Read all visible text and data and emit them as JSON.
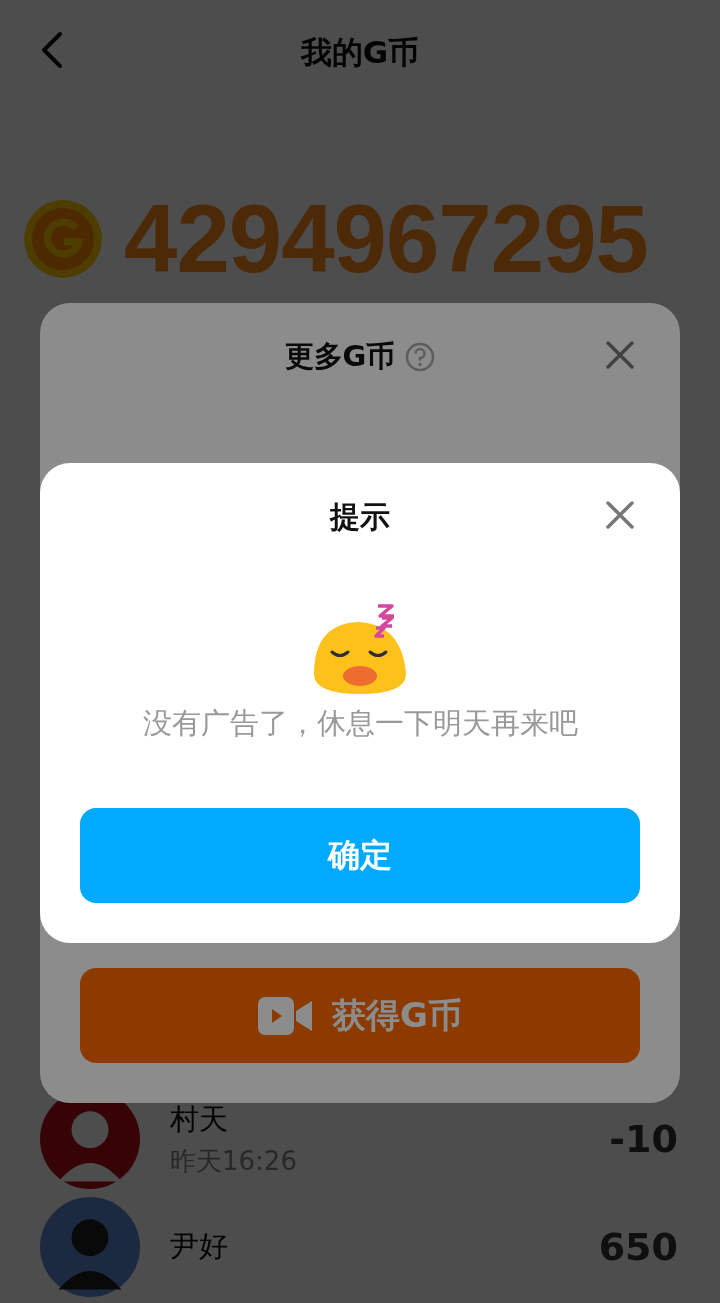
{
  "header": {
    "title": "我的G币"
  },
  "balance": "4294967295",
  "records": [
    {
      "name": "村天",
      "time": "昨天16:26",
      "amount": "-10"
    },
    {
      "name": "尹好",
      "amount": "650"
    }
  ],
  "sheet": {
    "title": "更多G币",
    "button": "获得G币"
  },
  "dialog": {
    "title": "提示",
    "message": "没有广告了，休息一下明天再来吧",
    "button": "确定"
  }
}
